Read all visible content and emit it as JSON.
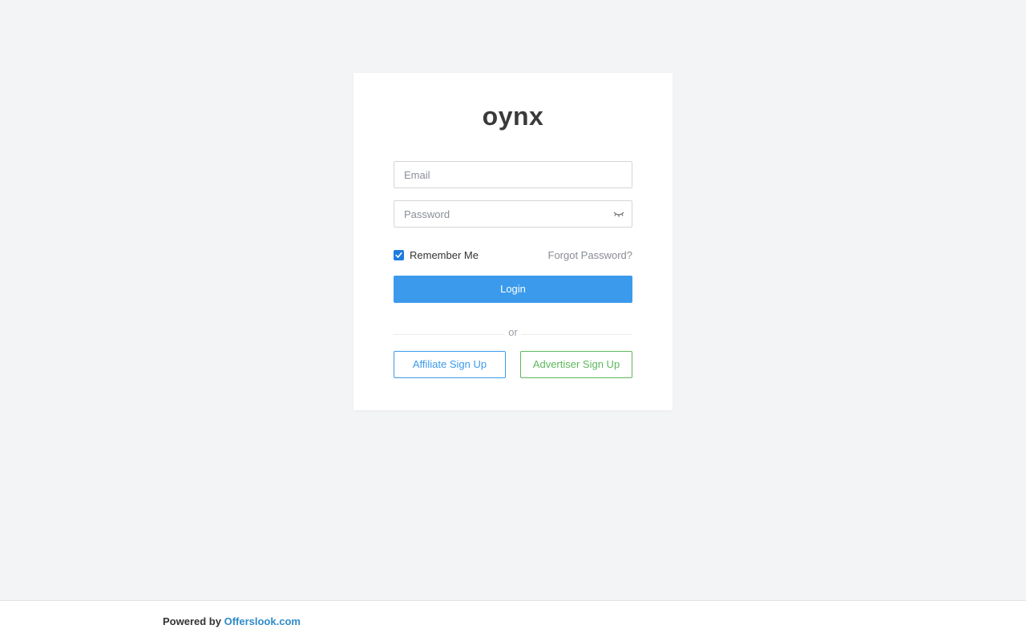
{
  "brand": {
    "name": "oynx"
  },
  "form": {
    "email_placeholder": "Email",
    "password_placeholder": "Password",
    "remember_label": "Remember Me",
    "remember_checked": true,
    "forgot_label": "Forgot Password?",
    "login_label": "Login",
    "divider_label": "or"
  },
  "signup": {
    "affiliate_label": "Affiliate Sign Up",
    "advertiser_label": "Advertiser Sign Up"
  },
  "footer": {
    "powered_by": "Powered by",
    "link_label": "Offerslook.com"
  },
  "icons": {
    "password_toggle": "eye-closed-icon",
    "checkbox": "check-icon"
  },
  "colors": {
    "accent": "#3b9aeb",
    "success": "#5cb85c",
    "background": "#f3f4f6",
    "link": "#2e8bc9"
  }
}
